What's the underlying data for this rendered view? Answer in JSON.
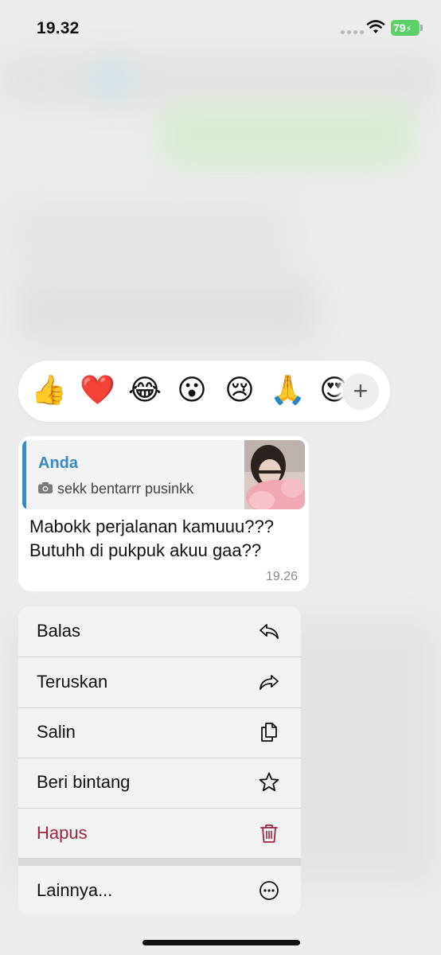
{
  "status_bar": {
    "time": "19.32",
    "battery": "79"
  },
  "reactions": {
    "emojis": [
      "👍",
      "❤️",
      "😂",
      "😮",
      "😢",
      "🙏",
      "😍"
    ],
    "more_label": "+"
  },
  "message": {
    "reply": {
      "author": "Anda",
      "text": "sekk bentarrr pusinkk",
      "icon": "camera-icon"
    },
    "text_line1": "Mabokk perjalanan kamuuu???",
    "text_line2": "Butuhh di pukpuk akuu gaa??",
    "time": "19.26"
  },
  "menu": {
    "items": [
      {
        "label": "Balas",
        "icon": "reply-icon"
      },
      {
        "label": "Teruskan",
        "icon": "forward-icon"
      },
      {
        "label": "Salin",
        "icon": "copy-icon"
      },
      {
        "label": "Beri bintang",
        "icon": "star-icon"
      },
      {
        "label": "Hapus",
        "icon": "trash-icon"
      },
      {
        "label": "Lainnya...",
        "icon": "more-icon"
      }
    ]
  },
  "colors": {
    "accent": "#3a88c5",
    "danger": "#a0243e",
    "battery": "#5dd06a"
  }
}
